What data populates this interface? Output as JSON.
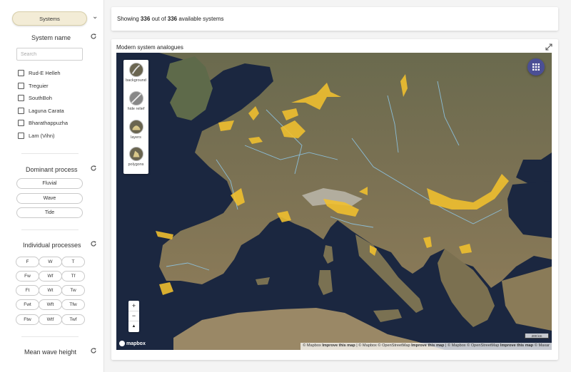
{
  "sidebar": {
    "systems_button": "Systems",
    "system_name": {
      "title": "System name",
      "search_placeholder": "Search",
      "items": [
        "Rud-E Helleh",
        "Treguier",
        "SouthBoh",
        "Laguna Carata",
        "Bharathappuzha",
        "Lam (Vihn)"
      ]
    },
    "dominant_process": {
      "title": "Dominant process",
      "options": [
        "Fluvial",
        "Wave",
        "Tide"
      ]
    },
    "individual_processes": {
      "title": "Individual processes",
      "options": [
        "F",
        "W",
        "T",
        "Fw",
        "Wf",
        "Tf",
        "Ft",
        "Wt",
        "Tw",
        "Fwt",
        "Wft",
        "Tfw",
        "Ftw",
        "Wtf",
        "Twf"
      ]
    },
    "mean_wave_height": {
      "title": "Mean wave height"
    }
  },
  "summary": {
    "prefix": "Showing",
    "shown": "336",
    "middle": "out of",
    "total": "336",
    "suffix": "available systems"
  },
  "map": {
    "title": "Modern system analogues",
    "layers": [
      "background",
      "hide relief",
      "layers",
      "polygons"
    ],
    "zoom_in": "+",
    "zoom_out": "−",
    "compass": "▲",
    "logo_text": "mapbox",
    "scale": "200 km",
    "attribution": {
      "p1": "© Mapbox",
      "improve1": "Improve this map",
      "p2": "| © Mapbox © OpenStreetMap",
      "improve2": "Improve this map",
      "p3": "| © Mapbox © OpenStreetMap",
      "improve3": "Improve this map",
      "p4": "© Maxar"
    }
  },
  "colors": {
    "accent": "#f3ecd6",
    "polygon": "#f2c12e",
    "sea": "#1b2740",
    "land": "#6f6a4e",
    "fab": "#4b4f95"
  },
  "icons": [
    "chevron-down-icon",
    "refresh-icon",
    "expand-icon",
    "grid-icon"
  ]
}
